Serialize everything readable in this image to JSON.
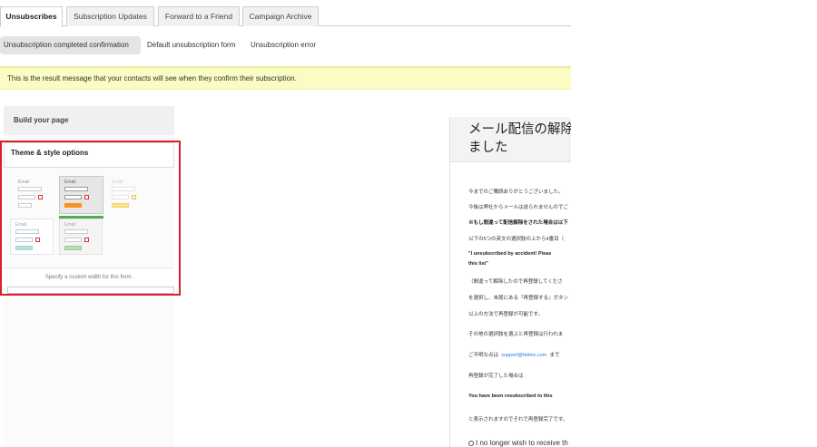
{
  "tabs": [
    {
      "label": "Unsubscribes",
      "active": true
    },
    {
      "label": "Subscription Updates",
      "active": false
    },
    {
      "label": "Forward to a Friend",
      "active": false
    },
    {
      "label": "Campaign Archive",
      "active": false
    }
  ],
  "subtabs": [
    {
      "label": "Unsubscription completed confirmation",
      "active": true
    },
    {
      "label": "Default unsubscription form",
      "active": false
    },
    {
      "label": "Unsubscription error",
      "active": false
    }
  ],
  "banner": {
    "text": "This is the result message that your contacts will see when they confirm their subscription."
  },
  "panel": {
    "header": "Build your page",
    "theme_title": "Theme & style options",
    "thumb_label": "Email",
    "custom_width_text": "Specify a custom width for this form."
  },
  "preview": {
    "title_line1": "メール配信の解除",
    "title_line2": "ました",
    "lines": [
      "今までのご購読ありがとうございました。",
      "今後は弊社からメールは送られませんのでご",
      "※もし間違って配信解除をされた場合は以下",
      "以下の5つの英文の選択肢の上から4番目（",
      "\"I unsubscribed by accident! Pleas",
      "this list\"",
      "（間違って解除したので再登録してくださ",
      "を選択し、末尾にある『再登録する』ボタン",
      "以上の方法で再登録が可能です。",
      "その他の選択肢を選ぶと再登録は行われま",
      "ご不明な点は",
      "support@hittinc.com",
      "まで",
      "再登録が完了した場合は",
      "You have been resubscribed to this",
      "と表示されますのでそれで再登録完了です。",
      "I no longer wish to receive th"
    ]
  },
  "colors": {
    "banner_bg": "#fbfcc2",
    "highlight": "#d81f2a",
    "selected_bar": "#4caf50",
    "link": "#2a7ae2"
  }
}
